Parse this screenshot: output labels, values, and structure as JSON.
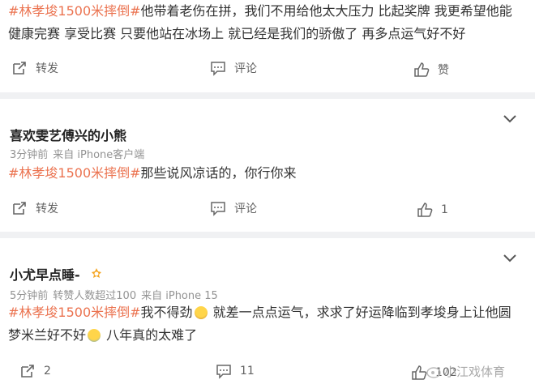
{
  "posts": [
    {
      "text_parts": [
        {
          "tag": "#林孝埈1500米摔倒#"
        },
        {
          "plain": "他带着老伤在拼，我们不用给他太大压力 比起奖牌 我更希望他能"
        }
      ],
      "line2": "健康完赛 享受比赛 只要他站在冰场上 就已经是我们的骄傲了 再多点运气好不好",
      "actions": {
        "repost": "转发",
        "comment": "评论",
        "like": "赞"
      }
    },
    {
      "author": "喜欢雯艺傅兴的小熊",
      "time": "3分钟前",
      "source": "来自 iPhone客户端",
      "tag": "#林孝埈1500米摔倒#",
      "text": "那些说风凉话的，你行你来",
      "actions": {
        "repost": "转发",
        "comment": "评论",
        "like": "1"
      }
    },
    {
      "author": "小尤早点睡-",
      "time": "5分钟前",
      "reposters": "转赞人数超过100",
      "source": "来自 iPhone 15",
      "tag": "#林孝埈1500米摔倒#",
      "text_a": "我不得劲",
      "text_b": "就差一点点运气，求求了好运降临到孝埈身上让他圆",
      "line2_a": "梦米兰好不好",
      "line2_b": "八年真的太难了",
      "actions": {
        "repost": "2",
        "comment": "11",
        "like": "102"
      }
    }
  ],
  "watermark": "小江戏体育",
  "colors": {
    "tag": "#eb7350",
    "meta": "#939393",
    "text": "#333333"
  }
}
